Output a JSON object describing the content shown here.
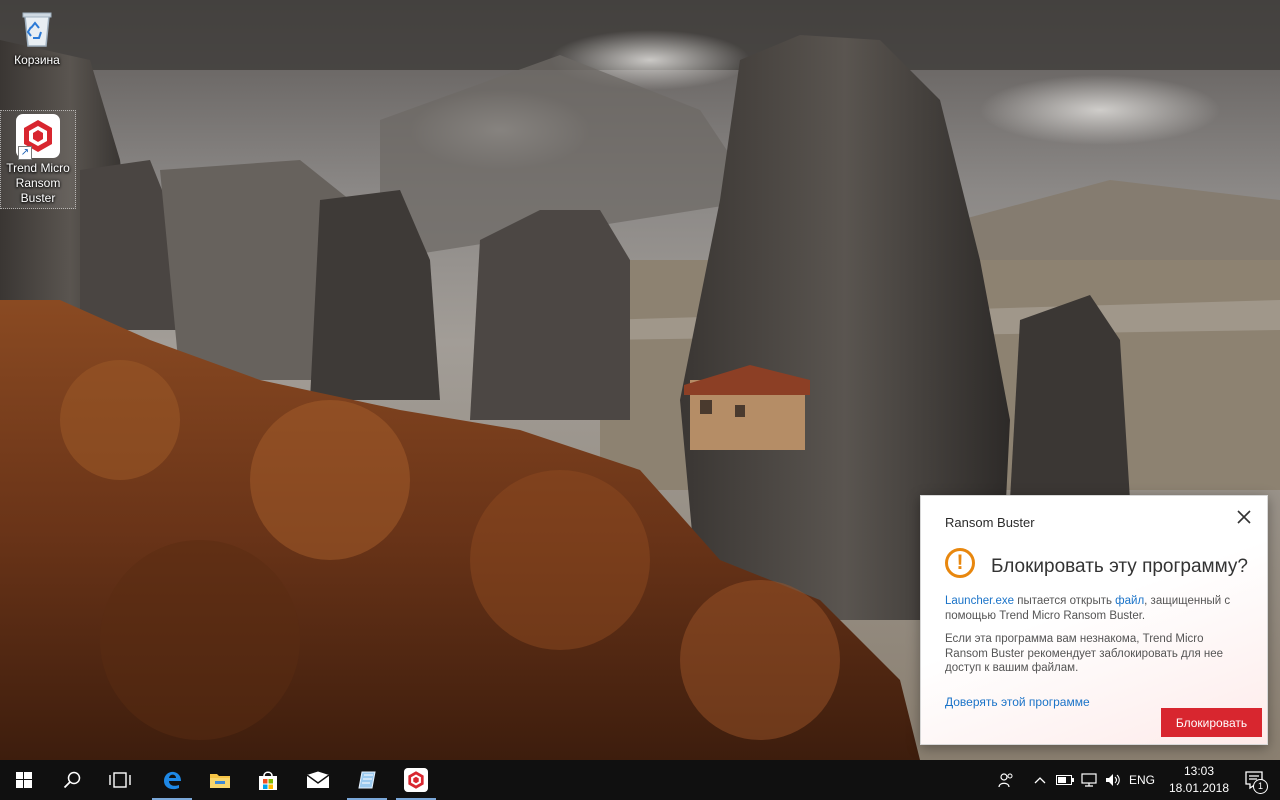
{
  "desktop": {
    "icons": [
      {
        "label": "Корзина",
        "icon": "recycle-bin-icon"
      },
      {
        "label": "Trend Micro Ransom Buster",
        "icon": "ransom-buster-icon"
      }
    ]
  },
  "popup": {
    "app_title": "Ransom Buster",
    "heading": "Блокировать эту программу?",
    "para1": {
      "program": "Launcher.exe",
      "text1": " пытается открыть ",
      "file_link": "файл",
      "text2": ", защищенный с помощью Trend Micro Ransom Buster."
    },
    "para2": "Если эта программа вам незнакома, Trend Micro Ransom Buster рекомендует заблокировать для нее доступ к вашим файлам.",
    "trust_link": "Доверять этой программе",
    "block_button": "Блокировать",
    "close_icon": "close-icon",
    "warning_icon": "warning-icon",
    "accent_color": "#d8262f",
    "warning_color": "#e8870e"
  },
  "taskbar": {
    "buttons": [
      {
        "name": "start-button",
        "icon": "windows-logo-icon"
      },
      {
        "name": "search-button",
        "icon": "search-icon"
      },
      {
        "name": "task-view-button",
        "icon": "task-view-icon"
      },
      {
        "name": "edge-button",
        "icon": "edge-icon"
      },
      {
        "name": "file-explorer-button",
        "icon": "folder-icon"
      },
      {
        "name": "store-button",
        "icon": "store-icon"
      },
      {
        "name": "mail-button",
        "icon": "mail-icon"
      },
      {
        "name": "app-button",
        "icon": "app-icon"
      },
      {
        "name": "ransom-buster-button",
        "icon": "ransom-buster-icon"
      }
    ],
    "tray": {
      "language": "ENG",
      "time": "13:03",
      "date": "18.01.2018",
      "notifications_count": "1"
    }
  }
}
